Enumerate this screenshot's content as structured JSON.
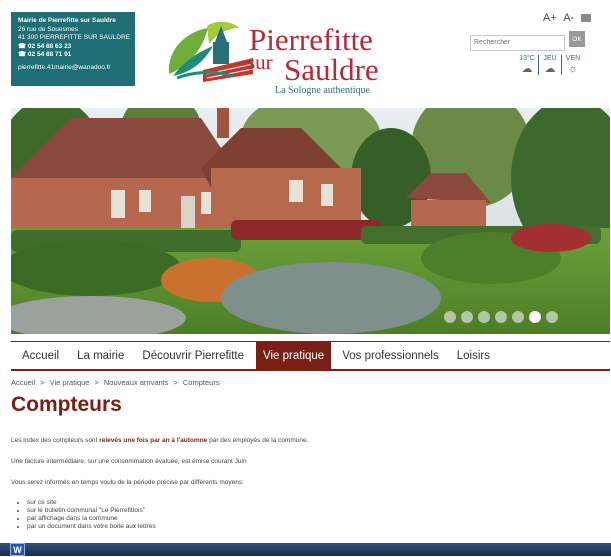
{
  "contact": {
    "name": "Mairie de Pierrefitte sur Sauldre",
    "address1": "26 rue de Souesmes",
    "address2": "41 300 PIERREFITTE SUR SAULDRE",
    "phone": "02 54 88 63 23",
    "fax": "02 54 88 71 91",
    "email": "pierrefitte.41mairie@wanadoo.fr"
  },
  "logo": {
    "line1": "Pierrefitte",
    "sur": "sur",
    "line2": "Sauldre",
    "tagline": "La Sologne authentique"
  },
  "font_size": {
    "increase": "A+",
    "decrease": "A-"
  },
  "search": {
    "placeholder": "Rechercher",
    "button": "OK"
  },
  "weather": [
    {
      "label": "13°C",
      "icon": "cloud-icon"
    },
    {
      "label": "JEU",
      "icon": "cloud-icon"
    },
    {
      "label": "VEN",
      "icon": "sun-icon"
    }
  ],
  "slider": {
    "slide_count": 7,
    "active_index": 5
  },
  "nav": {
    "items": [
      "Accueil",
      "La mairie",
      "Découvrir Pierrefitte",
      "Vie pratique",
      "Vos professionnels",
      "Loisirs"
    ],
    "active": "Vie pratique"
  },
  "breadcrumb": [
    "Accueil",
    "Vie pratique",
    "Nouveaux arrivants",
    "Compteurs"
  ],
  "page_title": "Compteurs",
  "content": {
    "p1_before": "Les index des compteurs sont ",
    "p1_bold": "relevés une fois par an à l'automne",
    "p1_after": " par des employés de la commune.",
    "p2": "Une facture intermédiaire, sur une consommation évaluée, est émise courant Juin",
    "p3": "Vous serez informés en temps voulu de la période précise par différents moyens:",
    "list": [
      "sur ce site",
      "sur le bulletin communal \"Le Pierrefittois\"",
      "par affichage dans la commune",
      "par un document dans votre boite aux lettres"
    ]
  },
  "taskbar": {
    "app_icon": "W"
  },
  "colors": {
    "brand_red": "#7a1f14",
    "logo_red": "#b5293b",
    "teal": "#1f6e75"
  }
}
